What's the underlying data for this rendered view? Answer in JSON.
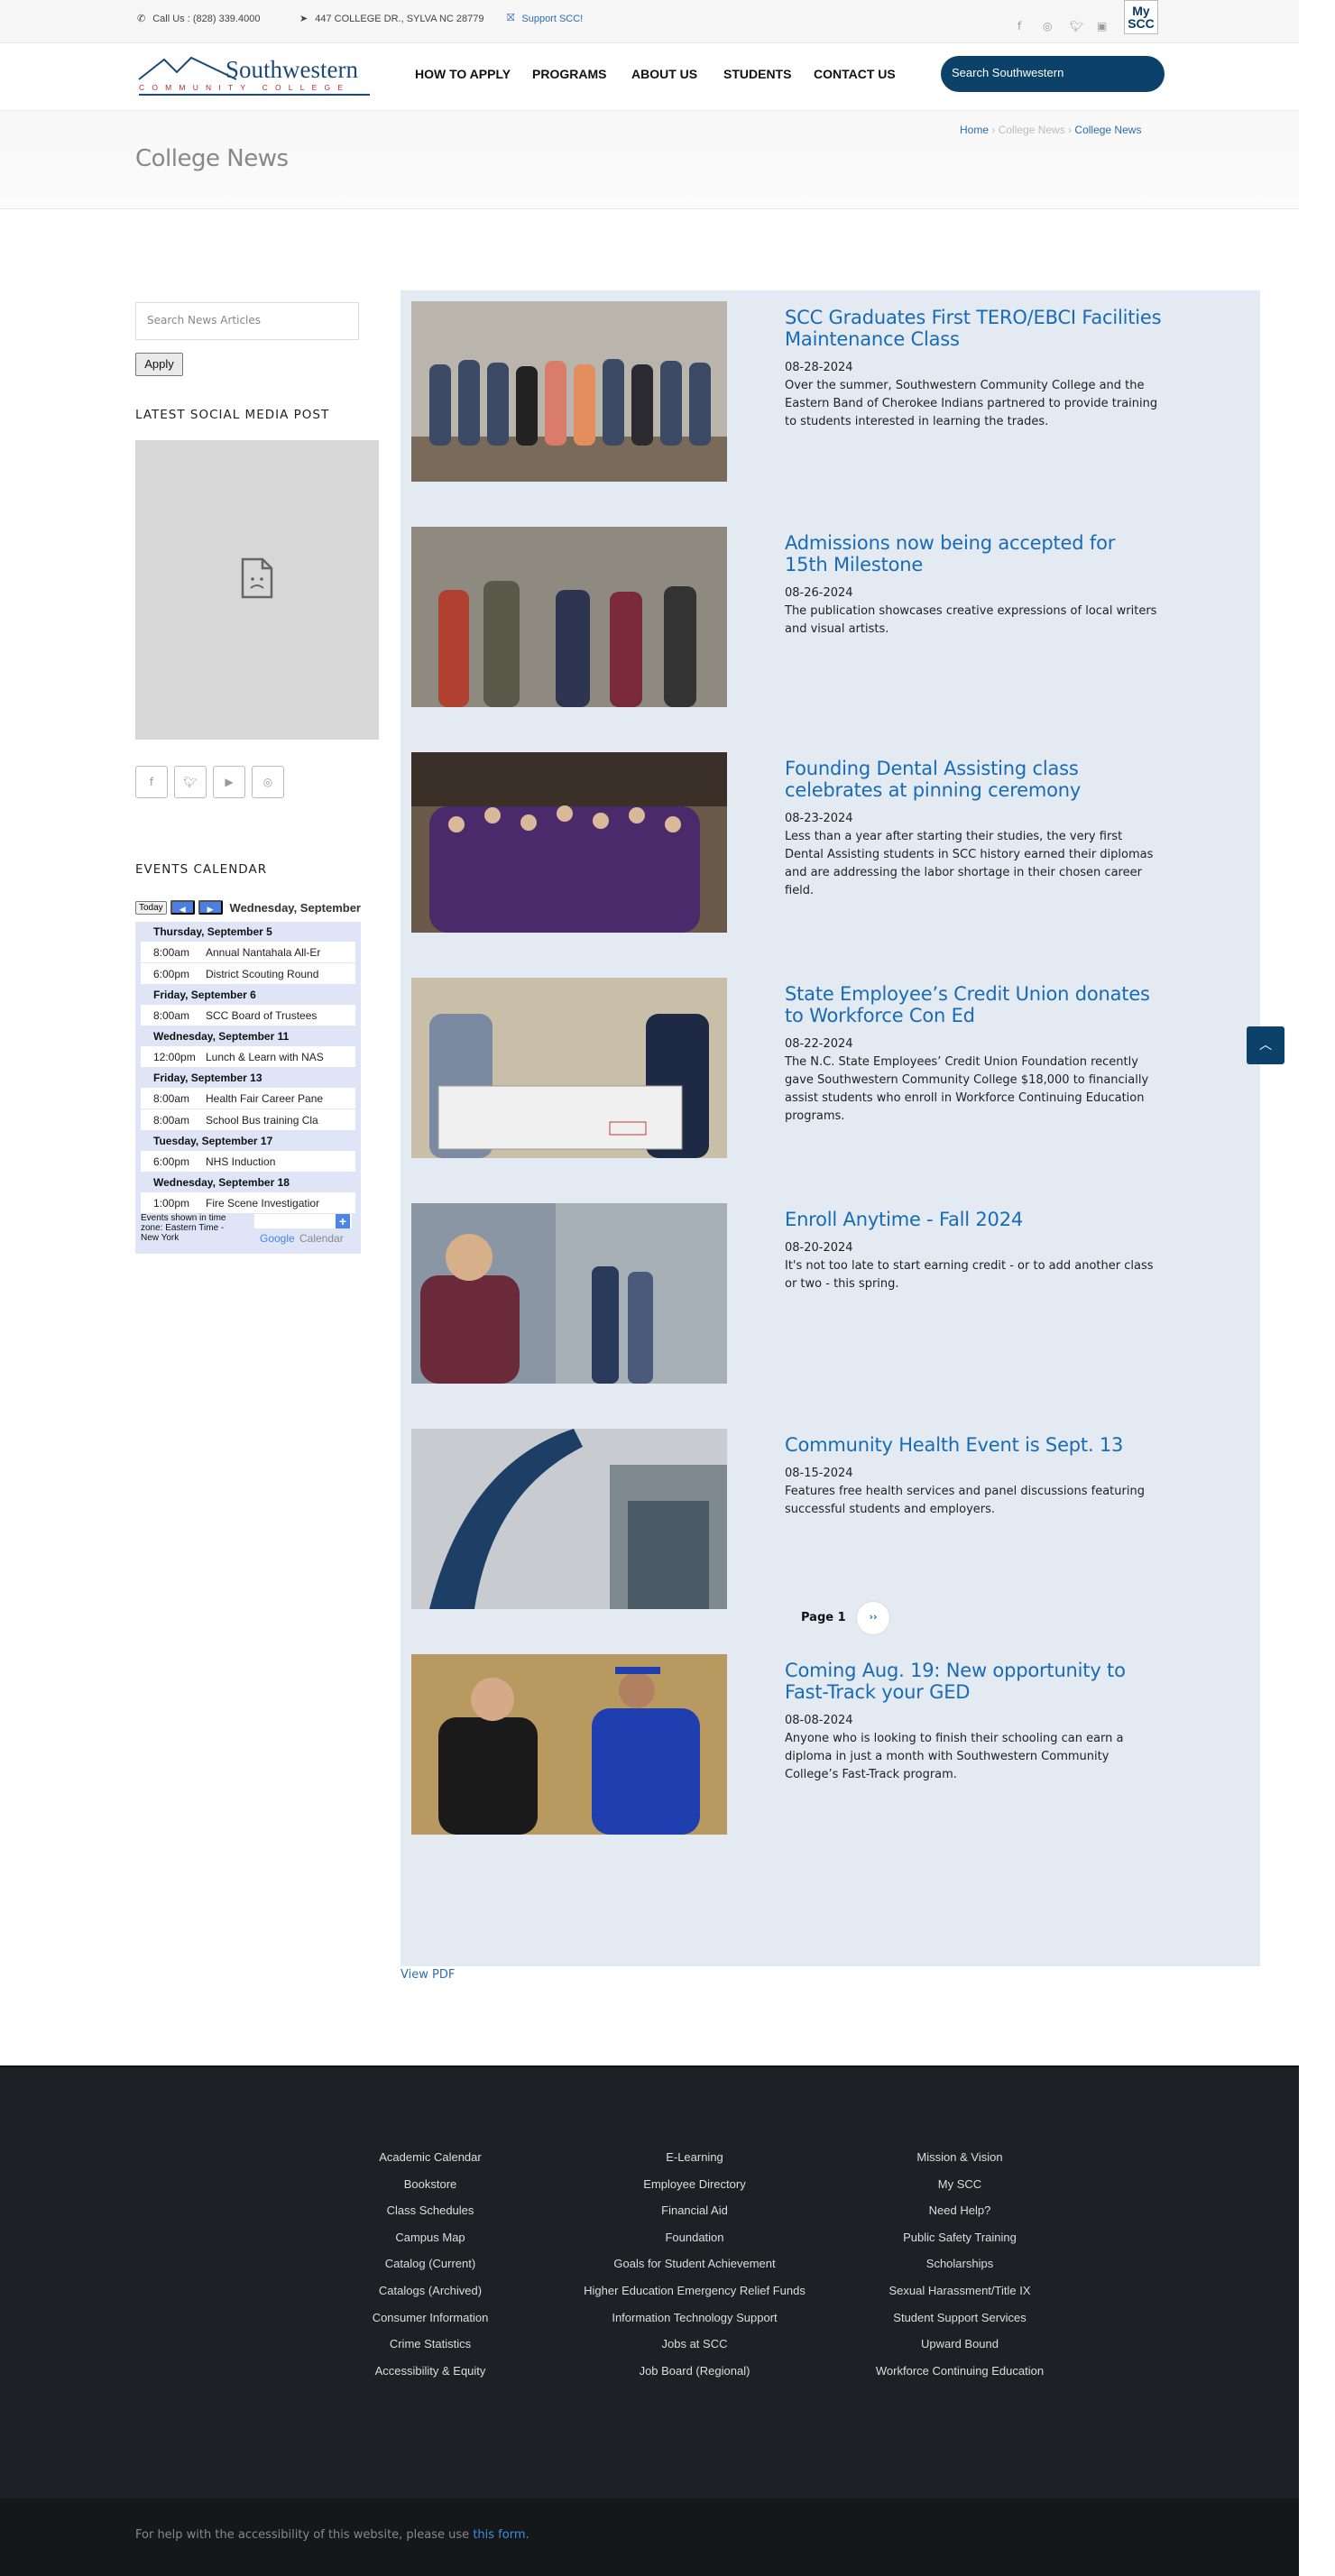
{
  "topbar": {
    "phone": "Call Us : (828) 339.4000",
    "address": "447 COLLEGE DR., SYLVA NC 28779",
    "support": "Support SCC!",
    "social": [
      "facebook-icon",
      "instagram-icon",
      "twitter-icon",
      "youtube-icon"
    ],
    "myscc_line1": "My",
    "myscc_line2": "SCC"
  },
  "header": {
    "logo_name": "Southwestern",
    "logo_sub": "COMMUNITY COLLEGE",
    "nav": [
      "HOW TO APPLY",
      "PROGRAMS",
      "ABOUT US",
      "STUDENTS",
      "CONTACT US"
    ],
    "search_placeholder": "Search Southwestern"
  },
  "titlebar": {
    "title": "College News",
    "breadcrumb": [
      "Home",
      "College News",
      "College News"
    ]
  },
  "sidebar": {
    "search_placeholder": "Search News Articles",
    "apply_label": "Apply",
    "social_heading": "LATEST SOCIAL MEDIA POST",
    "social_buttons": [
      "f",
      "t",
      "yt",
      "ig"
    ],
    "events_heading": "EVENTS CALENDAR",
    "calendar": {
      "today_label": "Today",
      "current_date": "Wednesday, September",
      "days": [
        {
          "date": "Thursday, September 5",
          "events": [
            {
              "time": "8:00am",
              "title": "Annual Nantahala All-Er"
            },
            {
              "time": "6:00pm",
              "title": "District Scouting Round"
            }
          ]
        },
        {
          "date": "Friday, September 6",
          "events": [
            {
              "time": "8:00am",
              "title": "SCC Board of Trustees"
            }
          ]
        },
        {
          "date": "Wednesday, September 11",
          "events": [
            {
              "time": "12:00pm",
              "title": "Lunch & Learn with NAS"
            }
          ]
        },
        {
          "date": "Friday, September 13",
          "events": [
            {
              "time": "8:00am",
              "title": "Health Fair Career Pane"
            },
            {
              "time": "8:00am",
              "title": "School Bus training Cla"
            }
          ]
        },
        {
          "date": "Tuesday, September 17",
          "events": [
            {
              "time": "6:00pm",
              "title": "NHS Induction"
            }
          ]
        },
        {
          "date": "Wednesday, September 18",
          "events": [
            {
              "time": "1:00pm",
              "title": "Fire Scene Investigatior"
            }
          ]
        }
      ],
      "timezone_note": "Events shown in time zone: Eastern Time - New York",
      "google_label": "Google",
      "calendar_label": "Calendar"
    }
  },
  "news": [
    {
      "title": "SCC Graduates First TERO/EBCI Facilities Maintenance Class",
      "date": "08-28-2024",
      "summary": "Over the summer, Southwestern Community College and the Eastern Band of Cherokee Indians partnered to provide training to students interested in learning the trades."
    },
    {
      "title": "Admissions now being accepted for 15th Milestone",
      "date": "08-26-2024",
      "summary": "The publication showcases creative expressions of local writers and visual artists."
    },
    {
      "title": "Founding Dental Assisting class celebrates at pinning ceremony",
      "date": "08-23-2024",
      "summary": "Less than a year after starting their studies, the very first Dental Assisting students in SCC history earned their diplomas and are addressing the labor shortage in their chosen career field."
    },
    {
      "title": "State Employee’s Credit Union donates to Workforce Con Ed",
      "date": "08-22-2024",
      "summary": "The N.C. State Employees’ Credit Union Foundation recently gave Southwestern Community College $18,000 to financially assist students who enroll in Workforce Continuing Education programs."
    },
    {
      "title": "Enroll Anytime - Fall 2024",
      "date": "08-20-2024",
      "summary": "It's not too late to start earning credit - or to add another class or two - this spring."
    },
    {
      "title": "Community Health Event is Sept. 13",
      "date": "08-15-2024",
      "summary": "Features free health services and panel discussions featuring successful students and employers."
    },
    {
      "title": "Coming Aug. 19: New opportunity to Fast-Track your GED",
      "date": "08-08-2024",
      "summary": "Anyone who is looking to finish their schooling can earn a diploma in just a month with Southwestern Community College’s Fast-Track program."
    }
  ],
  "pager": {
    "label": "Page 1",
    "next": "››"
  },
  "view_pdf": "View PDF",
  "footer": {
    "col1": [
      "Academic Calendar",
      "Bookstore",
      "Class Schedules",
      "Campus Map",
      "Catalog (Current)",
      "Catalogs (Archived)",
      "Consumer Information",
      "Crime Statistics",
      "Accessibility & Equity"
    ],
    "col2": [
      "E-Learning",
      "Employee Directory",
      "Financial Aid",
      "Foundation",
      "Goals for Student Achievement",
      "Higher Education Emergency Relief Funds",
      "Information Technology Support",
      "Jobs at SCC",
      "Job Board (Regional)"
    ],
    "col3": [
      "Mission & Vision",
      "My SCC",
      "Need Help?",
      "Public Safety Training",
      "Scholarships",
      "Sexual Harassment/Title IX",
      "Student Support Services",
      "Upward Bound",
      "Workforce Continuing Education"
    ],
    "accessibility_text": "For help with the accessibility of this website, please use ",
    "accessibility_link": "this form",
    "accessibility_end": "."
  },
  "colors": {
    "brand_navy": "#0c4269",
    "link_blue": "#1a6bb5",
    "news_bg": "#e3eaf2",
    "footer_bg": "#1d2024"
  }
}
